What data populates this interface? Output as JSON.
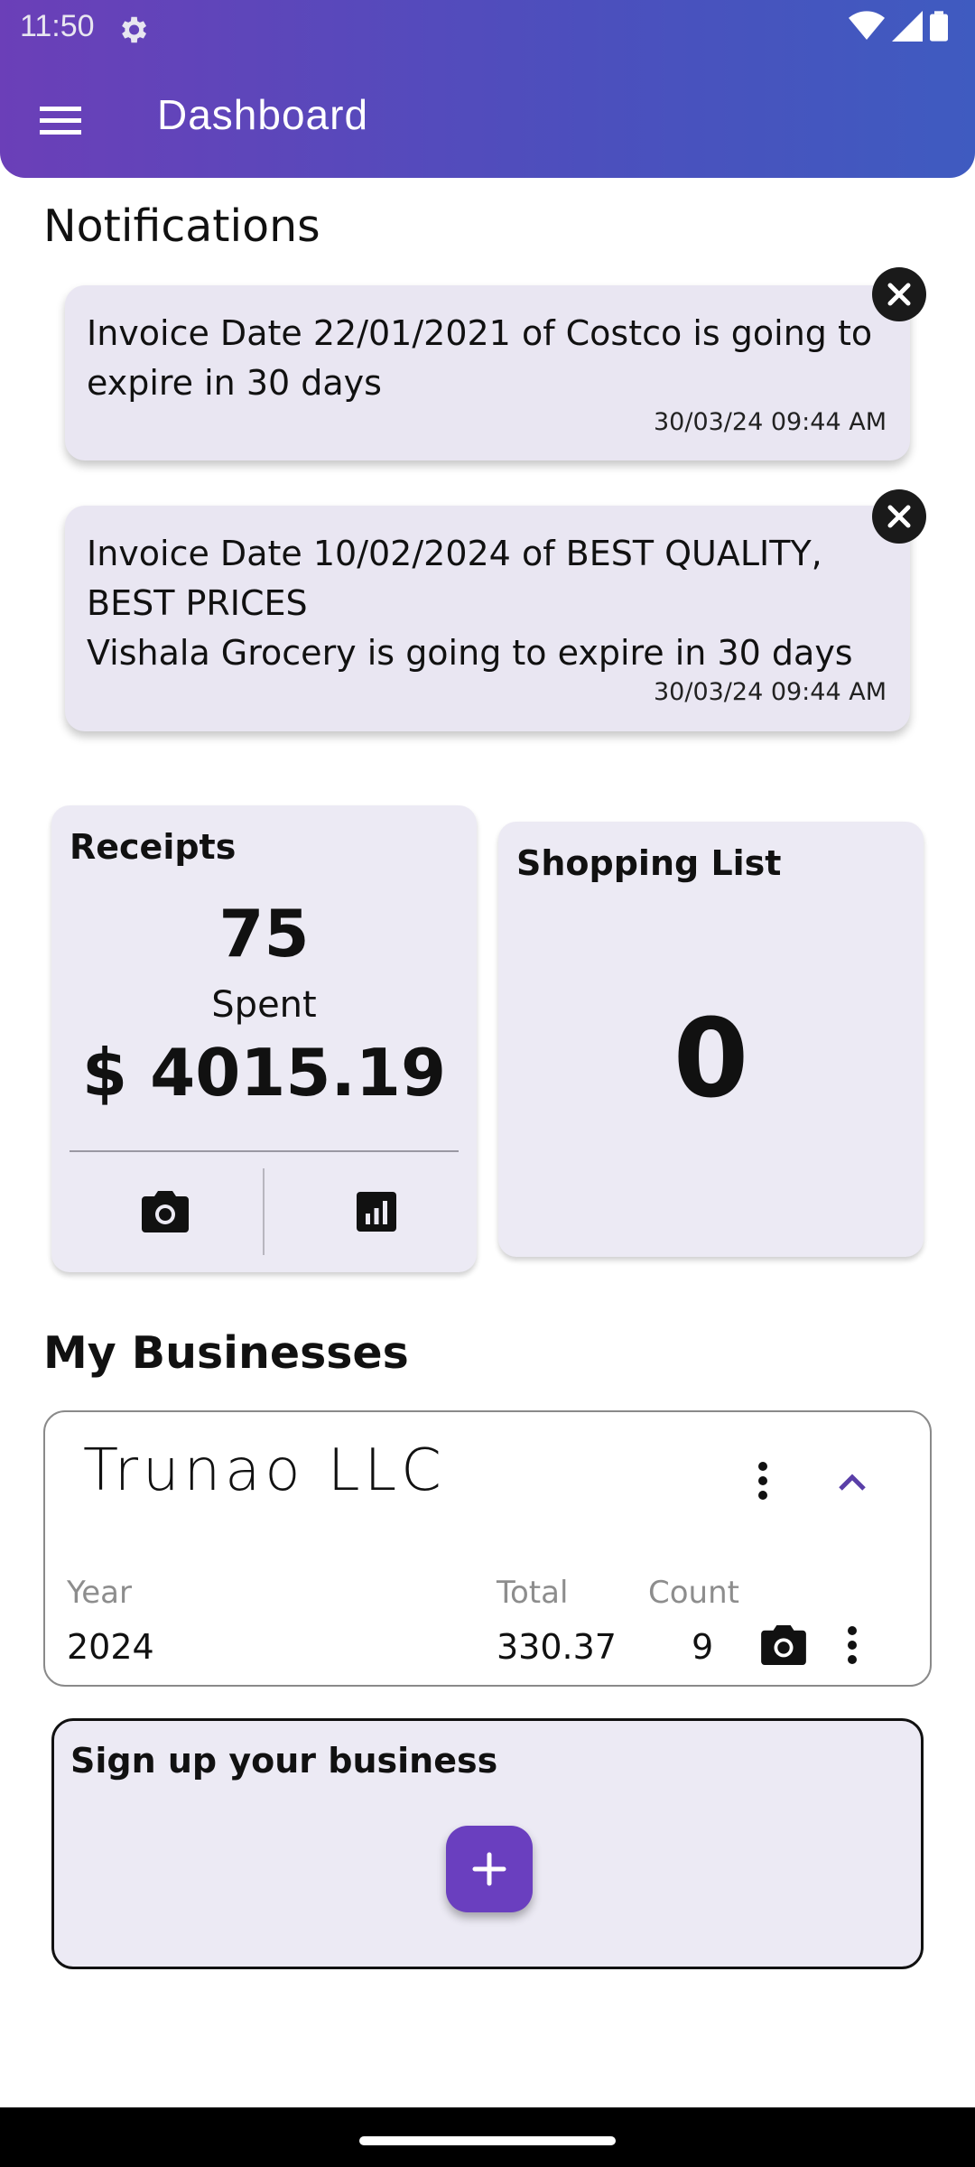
{
  "status": {
    "time": "11:50"
  },
  "appbar": {
    "title": "Dashboard"
  },
  "notifications": {
    "title": "Notifications",
    "items": [
      {
        "text": "Invoice Date 22/01/2021 of Costco is going to expire in 30 days",
        "time": "30/03/24 09:44 AM"
      },
      {
        "text": "Invoice Date 10/02/2024 of BEST QUALITY, BEST PRICES\nVishala Grocery is going to expire in 30 days",
        "time": "30/03/24 09:44 AM"
      }
    ]
  },
  "receipts": {
    "title": "Receipts",
    "count": "75",
    "spent_label": "Spent",
    "spent_value": "$ 4015.19"
  },
  "shopping_list": {
    "title": "Shopping List",
    "count": "0"
  },
  "businesses": {
    "title": "My Businesses",
    "items": [
      {
        "name": "Trunao LLC",
        "year_label": "Year",
        "year": "2024",
        "total_label": "Total",
        "total": "330.37",
        "count_label": "Count",
        "count": "9"
      }
    ]
  },
  "signup": {
    "title": "Sign up your business"
  },
  "colors": {
    "appbar_start": "#6b3fb8",
    "appbar_end": "#3f5bc0",
    "accent": "#6a3fbf",
    "card_bg": "#eceaf4"
  },
  "icons": [
    "gear-icon",
    "wifi-icon",
    "signal-icon",
    "battery-icon",
    "menu-icon",
    "close-icon",
    "camera-icon",
    "chart-icon",
    "more-vert-icon",
    "chevron-up-icon",
    "plus-icon"
  ]
}
